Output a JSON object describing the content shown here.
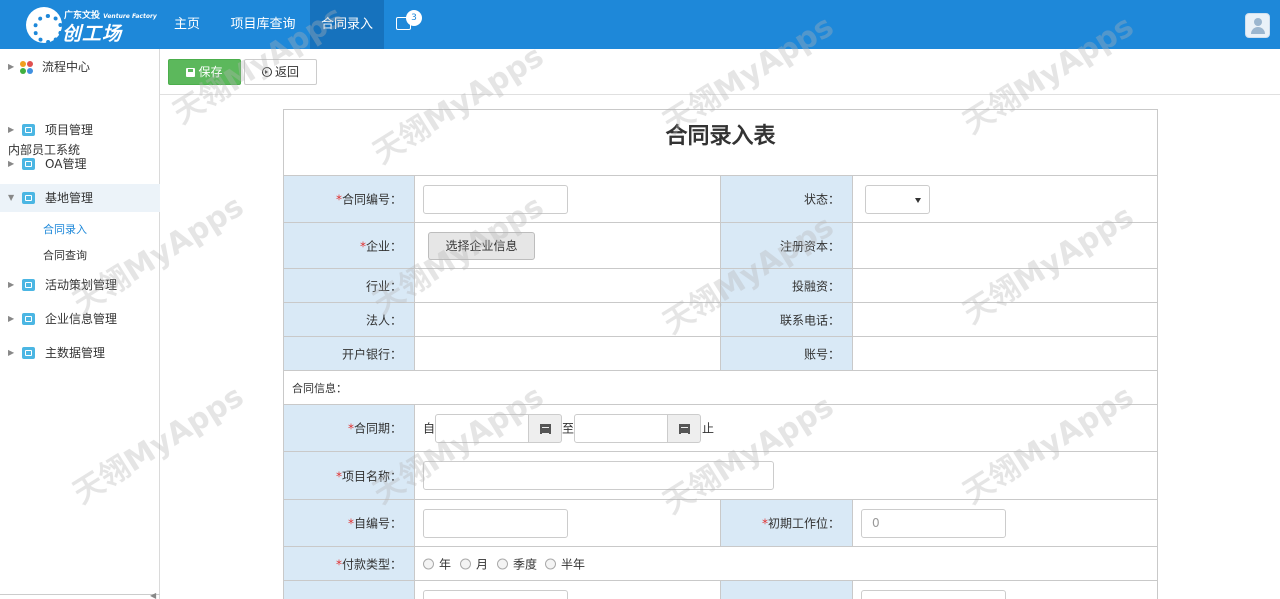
{
  "header": {
    "logo_small": "广东文投",
    "logo_small_en": "Venture Factory",
    "logo_big": "创工场",
    "nav": [
      {
        "label": "主页"
      },
      {
        "label": "项目库查询"
      },
      {
        "label": "合同录入"
      }
    ],
    "message_badge": "3"
  },
  "sidebar": {
    "flow_center": "流程中心",
    "section_title": "内部员工系统",
    "items": [
      {
        "label": "项目管理"
      },
      {
        "label": "OA管理"
      },
      {
        "label": "基地管理"
      },
      {
        "label": "活动策划管理"
      },
      {
        "label": "企业信息管理"
      },
      {
        "label": "主数据管理"
      }
    ],
    "subitems": [
      {
        "label": "合同录入"
      },
      {
        "label": "合同查询"
      }
    ]
  },
  "toolbar": {
    "save_label": "保存",
    "back_label": "返回"
  },
  "form": {
    "title": "合同录入表",
    "contract_no_label": "合同编号：",
    "status_label": "状态：",
    "company_label": "企业：",
    "choose_company_button": "选择企业信息",
    "registered_capital_label": "注册资本：",
    "industry_label": "行业：",
    "financing_label": "投融资：",
    "legal_person_label": "法人：",
    "phone_label": "联系电话：",
    "bank_label": "开户银行：",
    "account_label": "账号：",
    "contract_info_label": "合同信息：",
    "period_label": "合同期：",
    "period_from": "自",
    "period_to": "至",
    "period_end": "止",
    "project_name_label": "项目名称：",
    "self_no_label": "自编号：",
    "initial_workstations_label": "初期工作位：",
    "initial_workstations_value": "0",
    "payment_type_label": "付款类型：",
    "payment_options": [
      "年",
      "月",
      "季度",
      "半年"
    ],
    "required_mark": "*"
  },
  "watermark": "天翎MyApps",
  "colors": {
    "header_bg": "#1e88d9",
    "nav_active_bg": "#1672bd",
    "label_bg": "#d9e9f6",
    "save_button": "#5cb85c",
    "required": "#e03030"
  }
}
